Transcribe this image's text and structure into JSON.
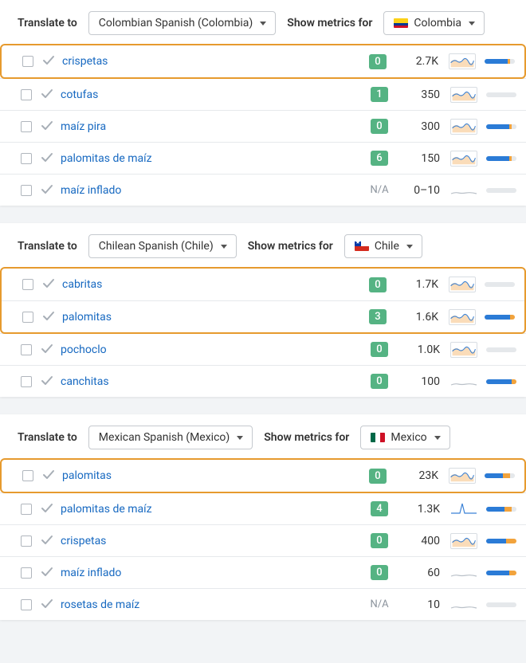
{
  "labels": {
    "translate_to": "Translate to",
    "show_metrics_for": "Show metrics for"
  },
  "panels": [
    {
      "language": "Colombian Spanish (Colombia)",
      "country": "Colombia",
      "flag": "co",
      "rows": [
        {
          "keyword": "crispetas",
          "kd": "0",
          "kd_na": false,
          "volume": "2.7K",
          "spark": "wave",
          "bar": {
            "blue": 30,
            "orange": 4,
            "grey": 6
          },
          "hl": true
        },
        {
          "keyword": "cotufas",
          "kd": "1",
          "kd_na": false,
          "volume": "350",
          "spark": "wave",
          "bar": {
            "blue": 0,
            "orange": 0,
            "grey": 40
          },
          "hl": false
        },
        {
          "keyword": "maíz pira",
          "kd": "0",
          "kd_na": false,
          "volume": "300",
          "spark": "wave",
          "bar": {
            "blue": 30,
            "orange": 4,
            "grey": 6
          },
          "hl": false
        },
        {
          "keyword": "palomitas de maíz",
          "kd": "6",
          "kd_na": false,
          "volume": "150",
          "spark": "wave",
          "bar": {
            "blue": 30,
            "orange": 4,
            "grey": 6
          },
          "hl": false
        },
        {
          "keyword": "maíz inflado",
          "kd": "N/A",
          "kd_na": true,
          "volume": "0–10",
          "spark": "flat",
          "bar": {
            "blue": 0,
            "orange": 0,
            "grey": 40
          },
          "hl": false
        }
      ]
    },
    {
      "language": "Chilean Spanish (Chile)",
      "country": "Chile",
      "flag": "cl",
      "rows": [
        {
          "keyword": "cabritas",
          "kd": "0",
          "kd_na": false,
          "volume": "1.7K",
          "spark": "wave",
          "bar": {
            "blue": 0,
            "orange": 0,
            "grey": 40
          },
          "hl": true
        },
        {
          "keyword": "palomitas",
          "kd": "3",
          "kd_na": false,
          "volume": "1.6K",
          "spark": "wave",
          "bar": {
            "blue": 34,
            "orange": 6,
            "grey": 0
          },
          "hl": true
        },
        {
          "keyword": "pochoclo",
          "kd": "0",
          "kd_na": false,
          "volume": "1.0K",
          "spark": "wave",
          "bar": {
            "blue": 0,
            "orange": 0,
            "grey": 40
          },
          "hl": false
        },
        {
          "keyword": "canchitas",
          "kd": "0",
          "kd_na": false,
          "volume": "100",
          "spark": "flat",
          "bar": {
            "blue": 34,
            "orange": 6,
            "grey": 0
          },
          "hl": false
        }
      ]
    },
    {
      "language": "Mexican Spanish (Mexico)",
      "country": "Mexico",
      "flag": "mx",
      "rows": [
        {
          "keyword": "palomitas",
          "kd": "0",
          "kd_na": false,
          "volume": "23K",
          "spark": "wave",
          "bar": {
            "blue": 24,
            "orange": 10,
            "grey": 6
          },
          "hl": true
        },
        {
          "keyword": "palomitas de maíz",
          "kd": "4",
          "kd_na": false,
          "volume": "1.3K",
          "spark": "spike",
          "bar": {
            "blue": 24,
            "orange": 10,
            "grey": 6
          },
          "hl": false
        },
        {
          "keyword": "crispetas",
          "kd": "0",
          "kd_na": false,
          "volume": "400",
          "spark": "wave",
          "bar": {
            "blue": 26,
            "orange": 14,
            "grey": 0
          },
          "hl": false
        },
        {
          "keyword": "maíz inflado",
          "kd": "0",
          "kd_na": false,
          "volume": "60",
          "spark": "flat",
          "bar": {
            "blue": 30,
            "orange": 10,
            "grey": 0
          },
          "hl": false
        },
        {
          "keyword": "rosetas de maíz",
          "kd": "N/A",
          "kd_na": true,
          "volume": "10",
          "spark": "flat",
          "bar": {
            "blue": 0,
            "orange": 0,
            "grey": 40
          },
          "hl": false
        }
      ]
    }
  ]
}
